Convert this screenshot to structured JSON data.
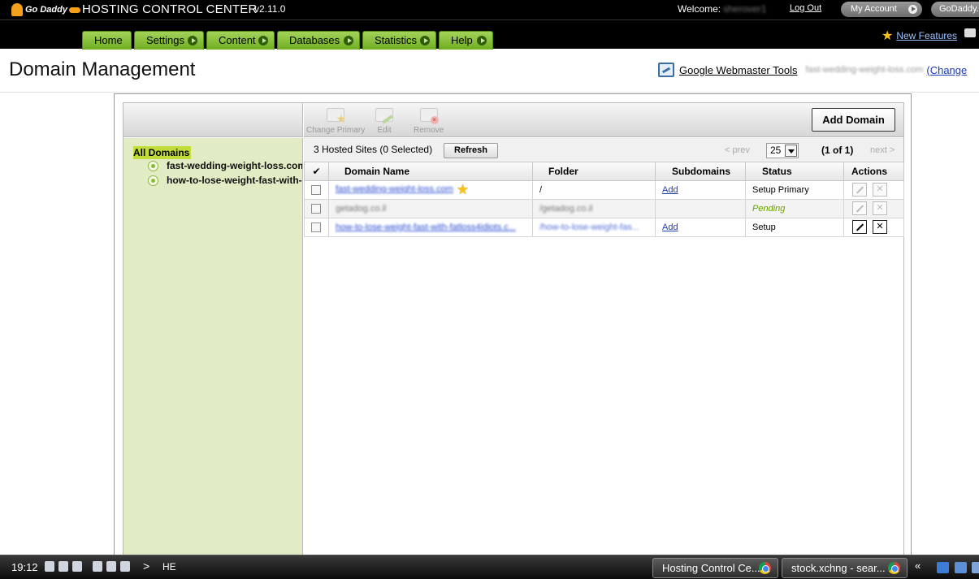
{
  "header": {
    "logo_text": "Go Daddy",
    "app_title": "HOSTING CONTROL CENTER",
    "version": "v2.11.0",
    "welcome_label": "Welcome:",
    "welcome_user": "sherover1",
    "logout": "Log Out",
    "my_account": "My Account",
    "godaddy": "GoDaddy.c"
  },
  "nav": {
    "tabs": [
      {
        "label": "Home"
      },
      {
        "label": "Settings"
      },
      {
        "label": "Content"
      },
      {
        "label": "Databases"
      },
      {
        "label": "Statistics"
      },
      {
        "label": "Help"
      }
    ],
    "new_features": "New Features"
  },
  "page": {
    "title": "Domain Management",
    "webmaster_tools": "Google Webmaster Tools",
    "current_domain": "fast-wedding-weight-loss.com",
    "change": "(Change"
  },
  "sidebar": {
    "all_domains": "All Domains",
    "items": [
      {
        "label": "fast-wedding-weight-loss.com"
      },
      {
        "label": "how-to-lose-weight-fast-with-"
      }
    ]
  },
  "toolbar": {
    "change_primary": "Change Primary",
    "edit": "Edit",
    "remove": "Remove",
    "add_domain": "Add Domain"
  },
  "summary": {
    "text": "3 Hosted Sites (0 Selected)",
    "refresh": "Refresh",
    "prev": "< prev",
    "per_page": "25",
    "page_info": "(1 of 1)",
    "next": "next >"
  },
  "table": {
    "headers": {
      "check": "✔",
      "domain": "Domain Name",
      "folder": "Folder",
      "subdomains": "Subdomains",
      "status": "Status",
      "actions": "Actions"
    },
    "rows": [
      {
        "domain": "fast-wedding-weight-loss.com",
        "folder": "/",
        "subdomains": "Add",
        "status": "Setup Primary"
      },
      {
        "domain": "getadog.co.il",
        "folder": "/getadog.co.il",
        "subdomains": "",
        "status": "Pending"
      },
      {
        "domain": "how-to-lose-weight-fast-with-fatloss4idiots.c...",
        "folder": "/how-to-lose-weight-fas...",
        "subdomains": "Add",
        "status": "Setup"
      }
    ]
  },
  "taskbar": {
    "clock": "19:12",
    "lang": "HE",
    "chevron": ">",
    "tasks": [
      {
        "label": "Hosting Control Ce..."
      },
      {
        "label": "stock.xchng - sear..."
      }
    ],
    "quick_chevron": "«"
  }
}
